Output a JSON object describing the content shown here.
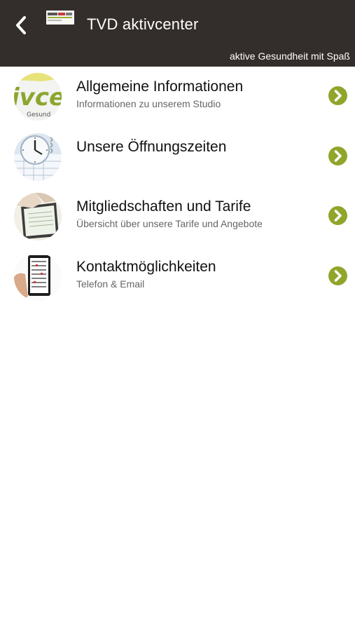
{
  "header": {
    "title": "TVD aktivcenter",
    "subtitle": "aktive Gesundheit mit Spaß",
    "back_icon": "chevron-left-icon",
    "background": "#332d2b"
  },
  "accent": "#8fa62b",
  "items": [
    {
      "title": "Allgemeine Informationen",
      "subtitle": "Informationen zu unserem Studio",
      "icon": "logo-thumbnail"
    },
    {
      "title": "Unsere Öffnungszeiten",
      "subtitle": "",
      "icon": "clock-calendar-thumbnail"
    },
    {
      "title": "Mitgliedschaften und Tarife",
      "subtitle": "Übersicht über unsere Tarife und Angebote",
      "icon": "tablet-document-thumbnail"
    },
    {
      "title": "Kontaktmöglichkeiten",
      "subtitle": "Telefon & Email",
      "icon": "contact-phone-thumbnail"
    }
  ]
}
